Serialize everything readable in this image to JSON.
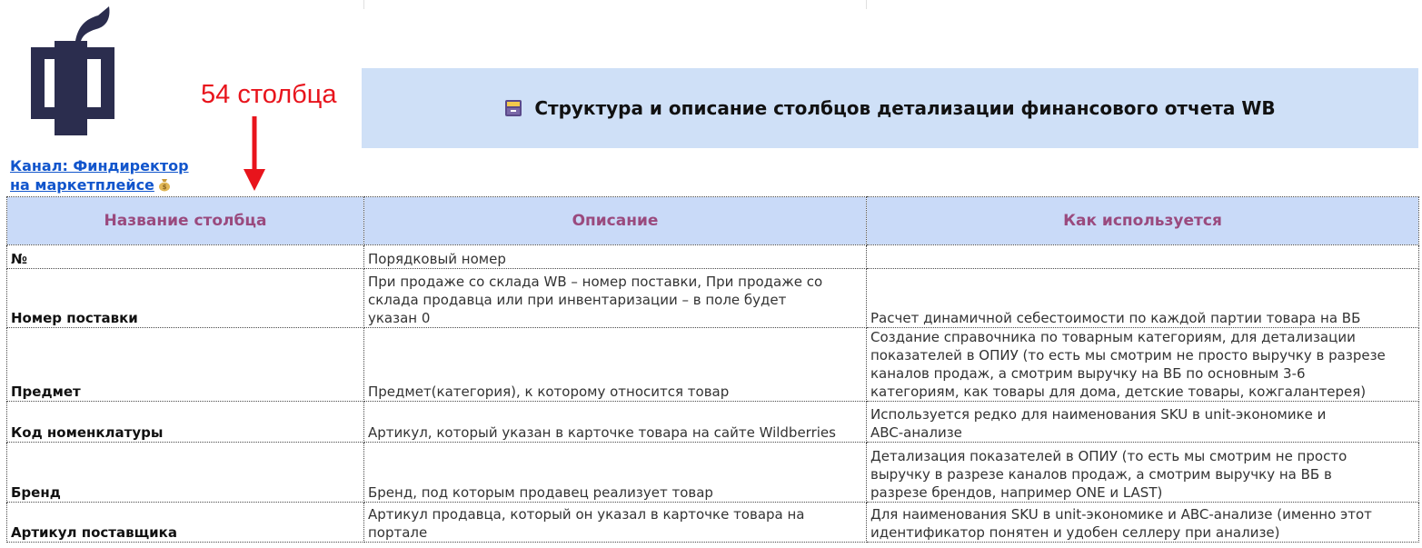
{
  "annotation": "54 столбца",
  "channel_link": {
    "line1": "Канал: Финдиректор",
    "line2": "на маркетплейсе"
  },
  "banner": {
    "title": "Структура и описание столбцов детализации финансового отчета WB"
  },
  "colors": {
    "logo": "#2b2d4e",
    "banner_bg": "#cfe0f7",
    "header_bg": "#c9daf8",
    "header_text": "#9a4a7e",
    "annotation": "#e8141c",
    "link": "#1155cc"
  },
  "icons": [
    "findirector-logo",
    "card-file-box-icon",
    "money-bag-icon",
    "arrow-down-icon"
  ],
  "table": {
    "headers": [
      "Название столбца",
      "Описание",
      "Как используется"
    ],
    "rows": [
      {
        "name": "№",
        "description": [
          "Порядковый номер"
        ],
        "usage": []
      },
      {
        "name": "Номер поставки",
        "description": [
          "При продаже со склада WB – номер поставки, При продаже со",
          "склада продавца или при инвентаризации – в поле будет",
          "указан 0"
        ],
        "usage": [
          "Расчет динамичной себестоимости по каждой партии товара на ВБ"
        ]
      },
      {
        "name": "Предмет",
        "description": [
          "Предмет(категория), к которому относится товар"
        ],
        "usage": [
          "Создание справочника по товарным категориям, для детализации",
          "показателей в ОПИУ (то есть мы смотрим не просто выручку в разрезе",
          "каналов продаж, а смотрим выручку на ВБ по основным 3-6",
          "категориям, как товары для дома, детские товары, кожгалантерея)"
        ]
      },
      {
        "name": "Код номенклатуры",
        "description": [
          "Артикул, который указан в карточке товара на сайте Wildberries"
        ],
        "usage": [
          "Используется редко для наименования SKU в unit-экономике и",
          "ABC-анализе"
        ]
      },
      {
        "name": "Бренд",
        "description": [
          "Бренд, под которым продавец реализует товар"
        ],
        "usage": [
          "Детализация показателей в ОПИУ (то есть мы смотрим не просто",
          "выручку в разрезе каналов продаж, а смотрим выручку на ВБ в",
          "разрезе брендов, например ONE и LAST)"
        ]
      },
      {
        "name": "Артикул поставщика",
        "description": [
          "Артикул продавца, который он указал в карточке товара на",
          "портале"
        ],
        "usage": [
          "Для наименования SKU в unit-экономике и ABC-анализе (именно этот",
          "идентификатор понятен и удобен селлеру при анализе)"
        ]
      }
    ]
  }
}
